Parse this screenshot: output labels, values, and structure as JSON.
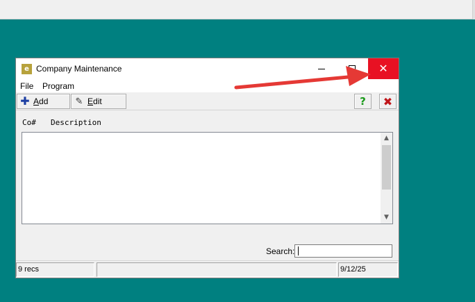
{
  "window": {
    "title": "Company Maintenance",
    "icon": "app-e-icon",
    "icon_glyph": "e",
    "close_glyph": "✕"
  },
  "menu": {
    "items": [
      {
        "label": "File"
      },
      {
        "label": "Program"
      }
    ]
  },
  "toolbar": {
    "add_prefix": "A",
    "add_rest": "dd",
    "edit_prefix": "E",
    "edit_rest": "dit",
    "help_glyph": "?",
    "close_glyph": "✖"
  },
  "table": {
    "columns": [
      "Co#",
      "Description"
    ],
    "rows": []
  },
  "search": {
    "label": "Search:",
    "value": ""
  },
  "status": {
    "records": "9 recs",
    "middle": "",
    "date": "9/12/25"
  },
  "colors": {
    "desktop": "#008080",
    "close_button": "#e81123",
    "annotation_arrow": "#e53935"
  }
}
